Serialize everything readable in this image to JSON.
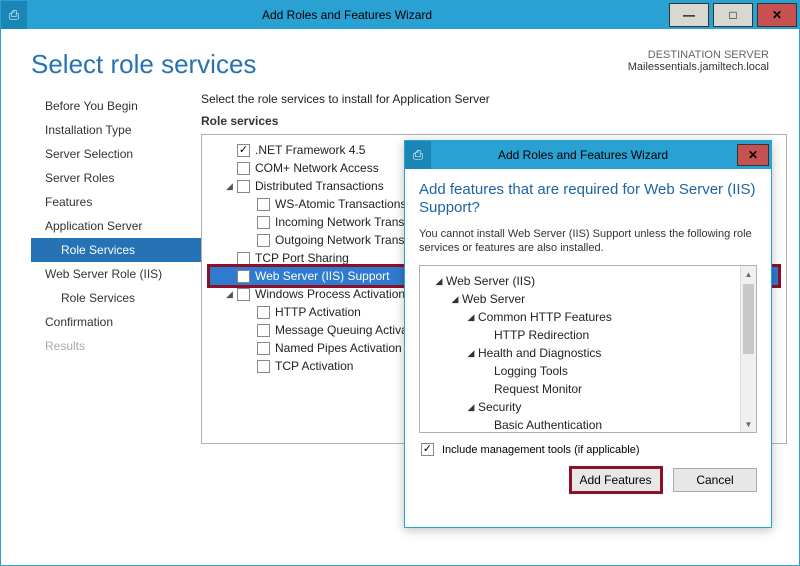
{
  "window": {
    "title": "Add Roles and Features Wizard",
    "sysicon": "⎙"
  },
  "heading": "Select role services",
  "destination": {
    "label": "DESTINATION SERVER",
    "value": "Mailessentials.jamiltech.local"
  },
  "nav": {
    "before": "Before You Begin",
    "install_type": "Installation Type",
    "server_sel": "Server Selection",
    "server_roles": "Server Roles",
    "features": "Features",
    "app_server": "Application Server",
    "role_services": "Role Services",
    "web_role": "Web Server Role (IIS)",
    "role_services2": "Role Services",
    "confirmation": "Confirmation",
    "results": "Results"
  },
  "content": {
    "instruction": "Select the role services to install for Application Server",
    "subheading": "Role services",
    "tree": {
      "net45": ".NET Framework 4.5",
      "comp": "COM+ Network Access",
      "dist": "Distributed Transactions",
      "ws_atomic": "WS-Atomic Transactions",
      "incoming": "Incoming Network Transactions",
      "outgoing": "Outgoing Network Transactions",
      "tcp_port": "TCP Port Sharing",
      "web_iis": "Web Server (IIS) Support",
      "wpa": "Windows Process Activation Service Support",
      "http_act": "HTTP Activation",
      "mq_act": "Message Queuing Activation",
      "np_act": "Named Pipes Activation",
      "tcp_act": "TCP Activation"
    }
  },
  "dialog": {
    "title": "Add Roles and Features Wizard",
    "heading": "Add features that are required for Web Server (IIS) Support?",
    "text": "You cannot install Web Server (IIS) Support unless the following role services or features are also installed.",
    "tree": {
      "r0": "Web Server (IIS)",
      "r1": "Web Server",
      "r2": "Common HTTP Features",
      "r3": "HTTP Redirection",
      "r4": "Health and Diagnostics",
      "r5": "Logging Tools",
      "r6": "Request Monitor",
      "r7": "Security",
      "r8": "Basic Authentication"
    },
    "mgmt_label": "Include management tools (if applicable)",
    "add": "Add Features",
    "cancel": "Cancel"
  }
}
